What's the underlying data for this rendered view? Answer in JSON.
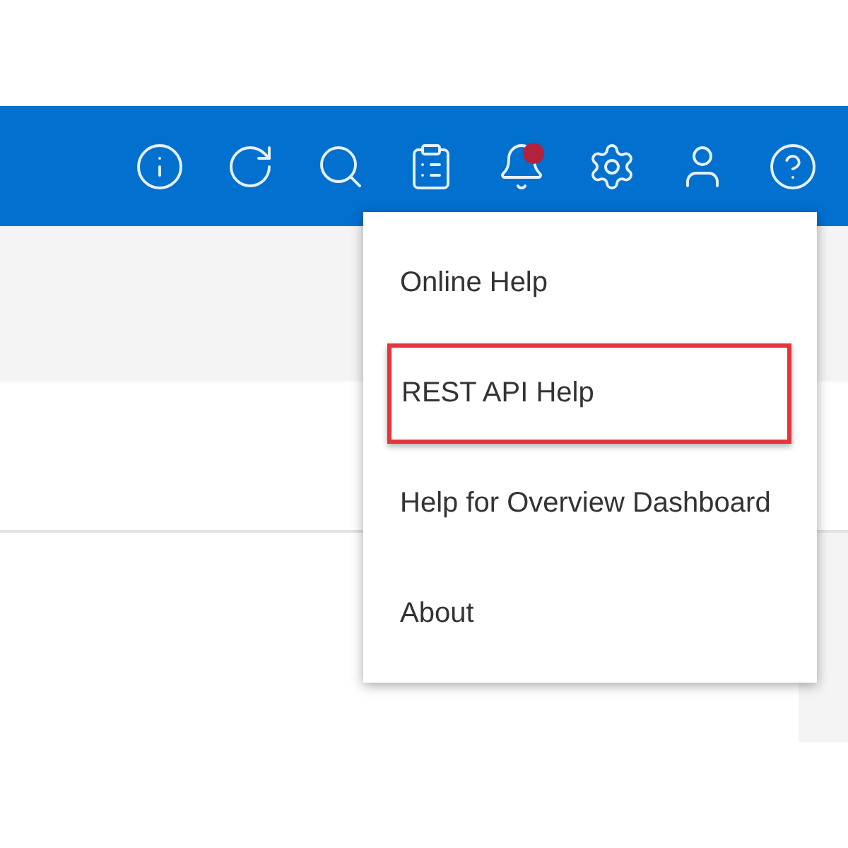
{
  "toolbar": {
    "icons": [
      {
        "kind": "info",
        "notification": false
      },
      {
        "kind": "refresh",
        "notification": false
      },
      {
        "kind": "search",
        "notification": false
      },
      {
        "kind": "tasks",
        "notification": false
      },
      {
        "kind": "bell",
        "notification": true
      },
      {
        "kind": "settings",
        "notification": false
      },
      {
        "kind": "user",
        "notification": false
      },
      {
        "kind": "help",
        "notification": false
      }
    ]
  },
  "help_menu": {
    "items": [
      {
        "label": "Online Help",
        "highlighted": false
      },
      {
        "label": "REST API Help",
        "highlighted": true
      },
      {
        "label": "Help for Overview Dashboard",
        "highlighted": false
      },
      {
        "label": "About",
        "highlighted": false
      }
    ]
  }
}
